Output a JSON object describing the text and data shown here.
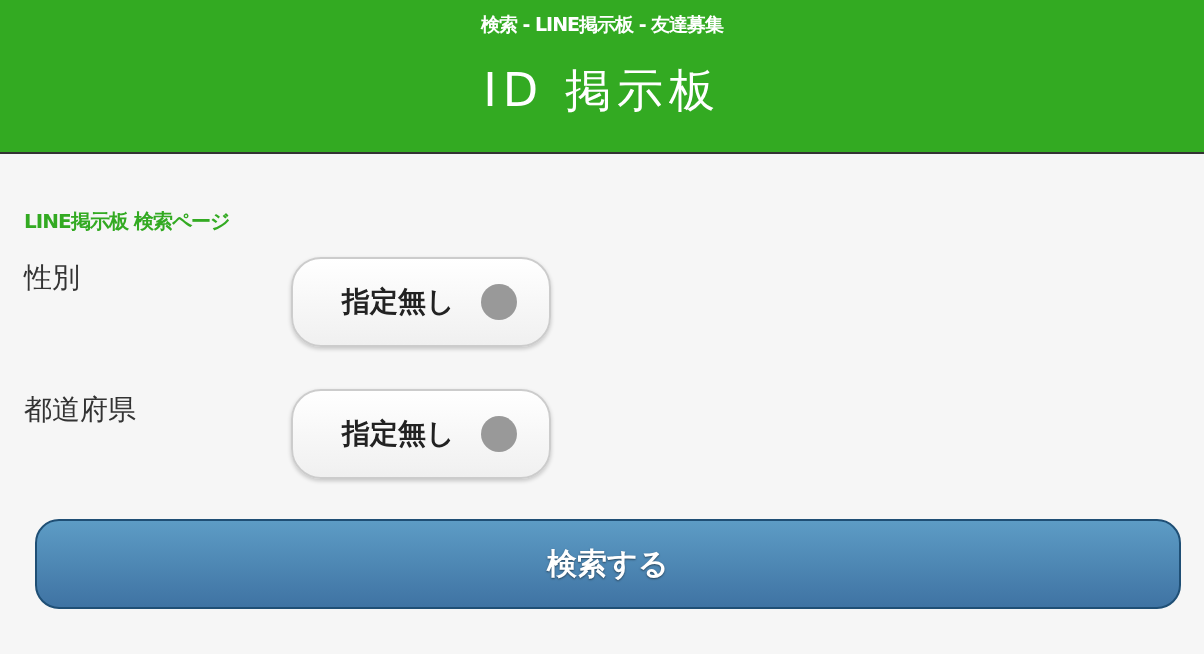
{
  "header": {
    "subtitle": "検索 - LINE掲示板 - 友達募集",
    "logo": "ID 掲示板"
  },
  "page_heading": "LINE掲示板 検索ページ",
  "fields": [
    {
      "label": "性別",
      "value": "指定無し"
    },
    {
      "label": "都道府県",
      "value": "指定無し"
    }
  ],
  "search_button": "検索する"
}
